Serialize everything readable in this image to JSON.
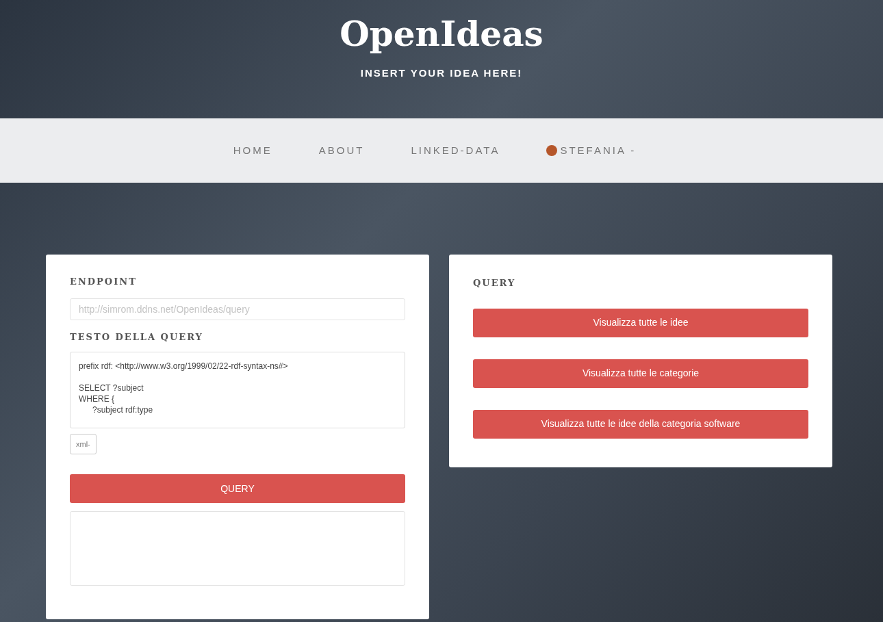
{
  "header": {
    "title": "OpenIdeas",
    "tagline": "INSERT YOUR IDEA HERE!"
  },
  "nav": {
    "items": [
      {
        "label": "HOME"
      },
      {
        "label": "ABOUT"
      },
      {
        "label": "LINKED-DATA"
      }
    ],
    "user": {
      "label": "STEFANIA",
      "caret": "-"
    }
  },
  "endpoint_card": {
    "endpoint_label": "ENDPOINT",
    "endpoint_placeholder": "http://simrom.ddns.net/OpenIdeas/query",
    "query_label": "TESTO DELLA QUERY",
    "query_text": "prefix rdf: <http://www.w3.org/1999/02/22-rdf-syntax-ns#>\n\nSELECT ?subject\nWHERE {\n      ?subject rdf:type",
    "format": "xml",
    "format_caret": "-",
    "submit": "QUERY"
  },
  "query_card": {
    "title": "QUERY",
    "buttons": [
      "Visualizza tutte le idee",
      "Visualizza tutte le categorie",
      "Visualizza tutte le idee della categoria software"
    ]
  }
}
